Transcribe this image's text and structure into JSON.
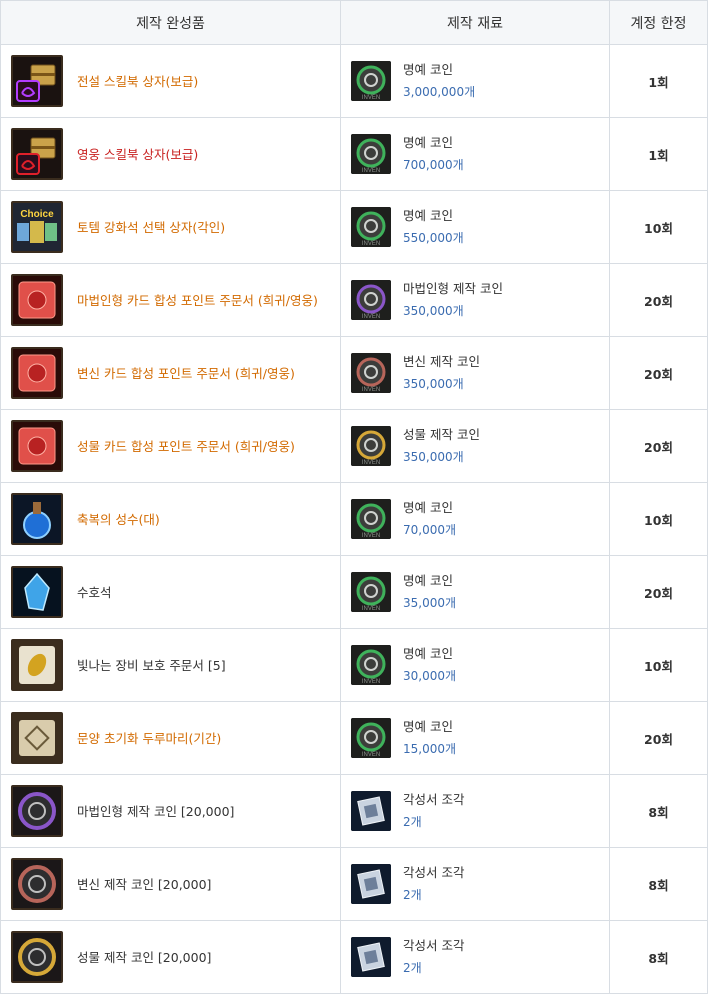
{
  "headers": {
    "result": "제작 완성품",
    "material": "제작 재료",
    "limit": "계정 한정"
  },
  "rows": [
    {
      "name": "전설 스킬북 상자(보급)",
      "name_color": "orange",
      "icon": "legend-skillbook-chest-icon",
      "material": "명예 코인",
      "material_icon": "honor-coin-icon",
      "qty": "3,000,000개",
      "limit": "1회"
    },
    {
      "name": "영웅 스킬북 상자(보급)",
      "name_color": "red",
      "icon": "hero-skillbook-chest-icon",
      "material": "명예 코인",
      "material_icon": "honor-coin-icon",
      "qty": "700,000개",
      "limit": "1회"
    },
    {
      "name": "토템 강화석 선택 상자(각인)",
      "name_color": "orange",
      "icon": "totem-choice-box-icon",
      "material": "명예 코인",
      "material_icon": "honor-coin-icon",
      "qty": "550,000개",
      "limit": "10회"
    },
    {
      "name": "마법인형 카드 합성 포인트 주문서 (희귀/영웅)",
      "name_color": "orange",
      "icon": "doll-card-scroll-icon",
      "material": "마법인형 제작 코인",
      "material_icon": "doll-coin-icon",
      "qty": "350,000개",
      "limit": "20회"
    },
    {
      "name": "변신 카드 합성 포인트 주문서 (희귀/영웅)",
      "name_color": "orange",
      "icon": "transform-card-scroll-icon",
      "material": "변신 제작 코인",
      "material_icon": "transform-coin-icon",
      "qty": "350,000개",
      "limit": "20회"
    },
    {
      "name": "성물 카드 합성 포인트 주문서 (희귀/영웅)",
      "name_color": "orange",
      "icon": "relic-card-scroll-icon",
      "material": "성물 제작 코인",
      "material_icon": "relic-coin-icon",
      "qty": "350,000개",
      "limit": "20회"
    },
    {
      "name": "축복의 성수(대)",
      "name_color": "orange",
      "icon": "blessed-water-icon",
      "material": "명예 코인",
      "material_icon": "honor-coin-icon",
      "qty": "70,000개",
      "limit": "10회"
    },
    {
      "name": "수호석",
      "name_color": "plain",
      "icon": "guardian-stone-icon",
      "material": "명예 코인",
      "material_icon": "honor-coin-icon",
      "qty": "35,000개",
      "limit": "20회"
    },
    {
      "name": "빛나는 장비 보호 주문서 [5]",
      "name_color": "plain",
      "icon": "equipment-protect-scroll-icon",
      "material": "명예 코인",
      "material_icon": "honor-coin-icon",
      "qty": "30,000개",
      "limit": "10회"
    },
    {
      "name": "문양 초기화 두루마리(기간)",
      "name_color": "orange",
      "icon": "pattern-reset-scroll-icon",
      "material": "명예 코인",
      "material_icon": "honor-coin-icon",
      "qty": "15,000개",
      "limit": "20회"
    },
    {
      "name": "마법인형 제작 코인 [20,000]",
      "name_color": "plain",
      "icon": "doll-coin-item-icon",
      "material": "각성서 조각",
      "material_icon": "awakening-fragment-icon",
      "qty": "2개",
      "limit": "8회"
    },
    {
      "name": "변신 제작 코인 [20,000]",
      "name_color": "plain",
      "icon": "transform-coin-item-icon",
      "material": "각성서 조각",
      "material_icon": "awakening-fragment-icon",
      "qty": "2개",
      "limit": "8회"
    },
    {
      "name": "성물 제작 코인 [20,000]",
      "name_color": "plain",
      "icon": "relic-coin-item-icon",
      "material": "각성서 조각",
      "material_icon": "awakening-fragment-icon",
      "qty": "2개",
      "limit": "8회"
    }
  ],
  "coin_watermark": "INVEN",
  "choice_label": "Choice",
  "colors": {
    "orange": "#d26a00",
    "red": "#c8201f",
    "qty_blue": "#3b6cb0",
    "border": "#d8dde3",
    "header_bg": "#f5f7f9"
  }
}
